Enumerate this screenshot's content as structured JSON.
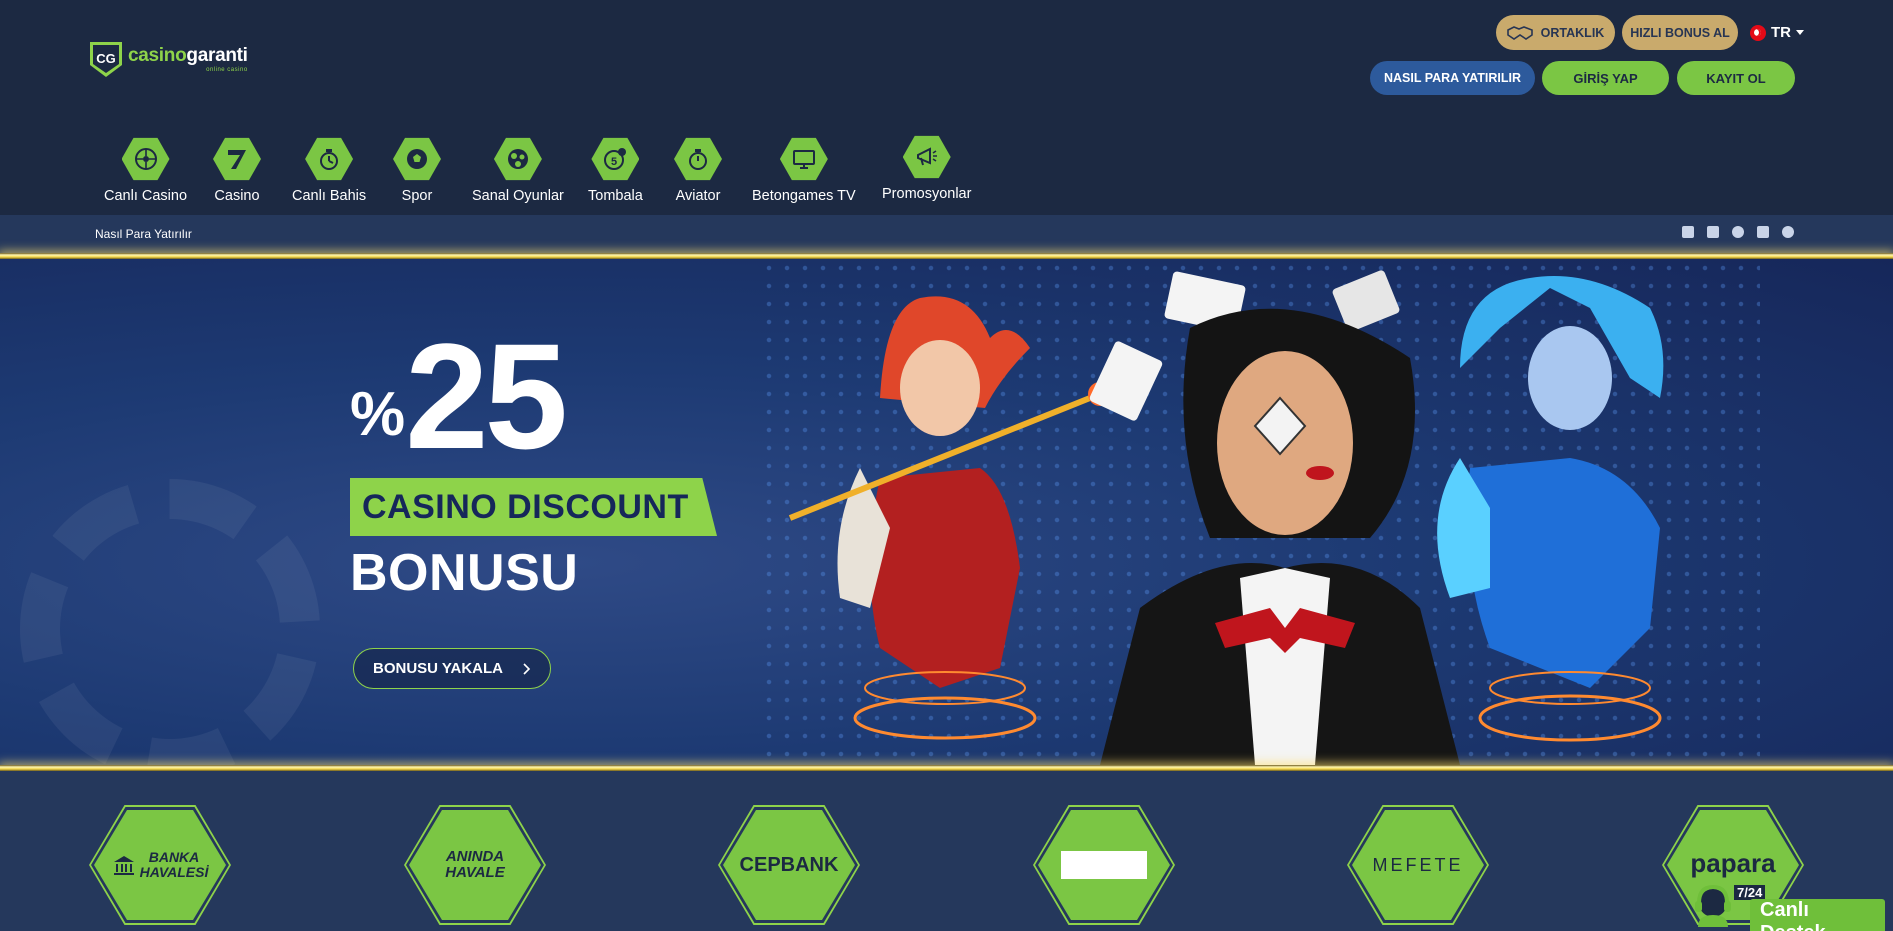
{
  "header": {
    "logo": {
      "brand_part1": "casino",
      "brand_part2": "garanti",
      "tagline": "online casino"
    },
    "partner_button": "ORTAKLIK",
    "bonus_button": "HIZLI BONUS AL",
    "language": "TR",
    "deposit_button": "NASIL PARA YATIRILIR",
    "login_button": "GİRİŞ YAP",
    "register_button": "KAYIT OL"
  },
  "nav": {
    "items": [
      {
        "label": "Canlı Casino",
        "icon": "roulette-icon"
      },
      {
        "label": "Casino",
        "icon": "slot-seven-icon"
      },
      {
        "label": "Canlı Bahis",
        "icon": "stopwatch-icon"
      },
      {
        "label": "Spor",
        "icon": "soccer-ball-icon"
      },
      {
        "label": "Sanal Oyunlar",
        "icon": "virtual-games-icon"
      },
      {
        "label": "Tombala",
        "icon": "bingo-ball-icon"
      },
      {
        "label": "Aviator",
        "icon": "stopwatch-icon"
      },
      {
        "label": "Betongames TV",
        "icon": "tv-icon"
      },
      {
        "label": "Promosyonlar",
        "icon": "megaphone-icon"
      }
    ]
  },
  "subbar": {
    "link": "Nasıl Para Yatırılır",
    "socials": [
      "facebook-icon",
      "twitter-icon",
      "instagram-icon",
      "youtube-icon",
      "pinterest-icon"
    ]
  },
  "hero": {
    "percent_sign": "%",
    "percent_value": "25",
    "band_text": "CASINO DISCOUNT",
    "bonus_word": "BONUSU",
    "cta_label": "BONUSU YAKALA"
  },
  "payments": {
    "methods": [
      {
        "label_line1": "BANKA",
        "label_line2": "HAVALESİ"
      },
      {
        "label_line1": "ANINDA",
        "label_line2": "HAVALE"
      },
      {
        "label_line1": "CEPBANK",
        "label_line2": ""
      },
      {
        "label_line1": "",
        "label_line2": ""
      },
      {
        "label_line1": "MEFETE",
        "label_line2": ""
      },
      {
        "label_line1": "papara",
        "label_line2": ""
      }
    ]
  },
  "support": {
    "badge": "7/24",
    "label": "Canlı Destek"
  },
  "colors": {
    "background": "#1c2942",
    "accent_green": "#7bc644",
    "gold": "#c9aa6c",
    "deposit_blue": "#2d5a9c"
  }
}
